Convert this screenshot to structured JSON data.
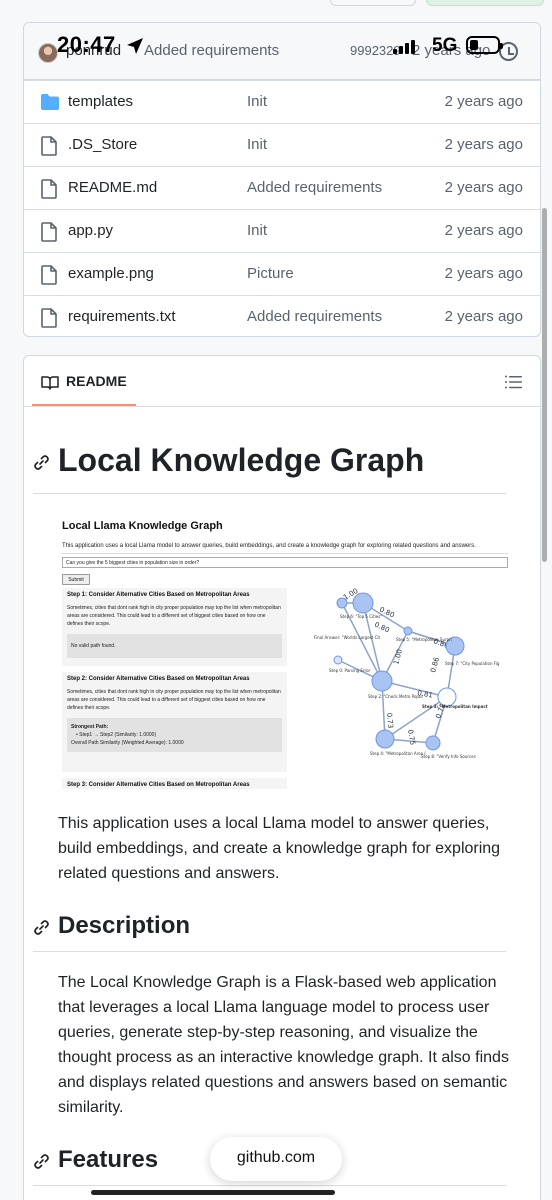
{
  "status_bar": {
    "time": "20:47",
    "network": "5G"
  },
  "latest_commit": {
    "user": "ponnrud",
    "message": "Added requirements",
    "hash": "9992329",
    "time": "2 years ago"
  },
  "files": [
    {
      "name": "templates",
      "type": "folder",
      "message": "Init",
      "time": "2 years ago"
    },
    {
      "name": ".DS_Store",
      "type": "file",
      "message": "Init",
      "time": "2 years ago"
    },
    {
      "name": "README.md",
      "type": "file",
      "message": "Added requirements",
      "time": "2 years ago"
    },
    {
      "name": "app.py",
      "type": "file",
      "message": "Init",
      "time": "2 years ago"
    },
    {
      "name": "example.png",
      "type": "file",
      "message": "Picture",
      "time": "2 years ago"
    },
    {
      "name": "requirements.txt",
      "type": "file",
      "message": "Added requirements",
      "time": "2 years ago"
    }
  ],
  "readme": {
    "tab_label": "README",
    "title": "Local Knowledge Graph",
    "intro": "This application uses a local Llama model to answer queries, build embeddings, and create a knowledge graph for exploring related questions and answers.",
    "description_heading": "Description",
    "description": "The Local Knowledge Graph is a Flask-based web application that leverages a local Llama language model to process user queries, generate step-by-step reasoning, and visualize the thought process as an interactive knowledge graph. It also finds and displays related questions and answers based on semantic similarity.",
    "features_heading": "Features"
  },
  "example_image": {
    "title": "Local Llama Knowledge Graph",
    "description": "This application uses a local Llama model to answer queries, build embeddings, and create a knowledge graph for exploring related questions and answers.",
    "query": "Can you give the 5 biggest cities in population size in order?",
    "submit_label": "Submit",
    "step1_title": "Step 1: Consider Alternative Cities Based on Metropolitan Areas",
    "step1_text": "Sometimes, cities that dont rank high in city proper population may top the list when metropolitan areas are considered. This could lead to a different set of biggest cities based on how one defines their scope.",
    "step1_result": "No valid path found.",
    "step2_title": "Step 2: Consider Alternative Cities Based on Metropolitan Areas",
    "step2_text": "Sometimes, cities that dont rank high in city proper population may top the list when metropolitan areas are considered. This could lead to a different set of biggest cities based on how one defines their scope.",
    "strongest_path_label": "Strongest Path:",
    "strongest_path_item": "Step1 → Step2 (Similarity: 1.0000)",
    "path_similarity": "Overall Path Similarity (Weighted Average): 1.0000",
    "step3_title": "Step 3: Consider Alternative Cities Based on Metropolitan Areas",
    "graph_labels": {
      "step6": "Step 6: \"Top 5 Cities\"",
      "final": "Final Answer: \"Worlds Largest Cit",
      "step5": "Step 5: \"Metropolitan Surpri",
      "step7": "Step 7: \"City Population Fig",
      "step0": "Step 0: Parsing Error",
      "step2": "Step 2: \"Check Metro Popul",
      "step3": "Step 3: \"Metropolitan Impact",
      "step4": "Step 4: \"Metropolitan Area I",
      "step8": "Step 8: \"Verify Info Sources"
    },
    "edge_labels": [
      "1.00",
      "0.80",
      "0.80",
      "0.86",
      "0.86",
      "1.00",
      "0.81",
      "0.73",
      "0.75",
      "0.79"
    ]
  },
  "url_bar": {
    "domain": "github.com"
  }
}
